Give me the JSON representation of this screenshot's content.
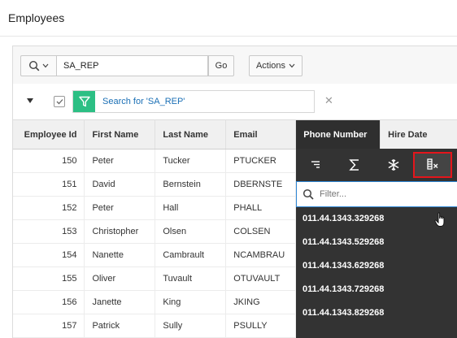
{
  "page": {
    "title": "Employees"
  },
  "toolbar": {
    "search_value": "SA_REP",
    "go_label": "Go",
    "actions_label": "Actions"
  },
  "filter": {
    "text": "Search for 'SA_REP'"
  },
  "table": {
    "columns": [
      "Employee Id",
      "First Name",
      "Last Name",
      "Email",
      "Phone Number",
      "Hire Date"
    ],
    "rows": [
      [
        "150",
        "Peter",
        "Tucker",
        "PTUCKER"
      ],
      [
        "151",
        "David",
        "Bernstein",
        "DBERNSTE"
      ],
      [
        "152",
        "Peter",
        "Hall",
        "PHALL"
      ],
      [
        "153",
        "Christopher",
        "Olsen",
        "COLSEN"
      ],
      [
        "154",
        "Nanette",
        "Cambrault",
        "NCAMBRAU"
      ],
      [
        "155",
        "Oliver",
        "Tuvault",
        "OTUVAULT"
      ],
      [
        "156",
        "Janette",
        "King",
        "JKING"
      ],
      [
        "157",
        "Patrick",
        "Sully",
        "PSULLY"
      ]
    ]
  },
  "column_menu": {
    "icons": [
      "sort-icon",
      "aggregate-icon",
      "freeze-icon",
      "hide-column-icon"
    ],
    "filter_placeholder": "Filter...",
    "values": [
      "011.44.1343.329268",
      "011.44.1343.529268",
      "011.44.1343.629268",
      "011.44.1343.729268",
      "011.44.1343.829268"
    ]
  },
  "colors": {
    "active_header": "#2f2f2f",
    "menu_bg": "#333333",
    "filter_green": "#2cbf84",
    "link_blue": "#1a6fb5",
    "highlight_red": "#e4151b"
  }
}
